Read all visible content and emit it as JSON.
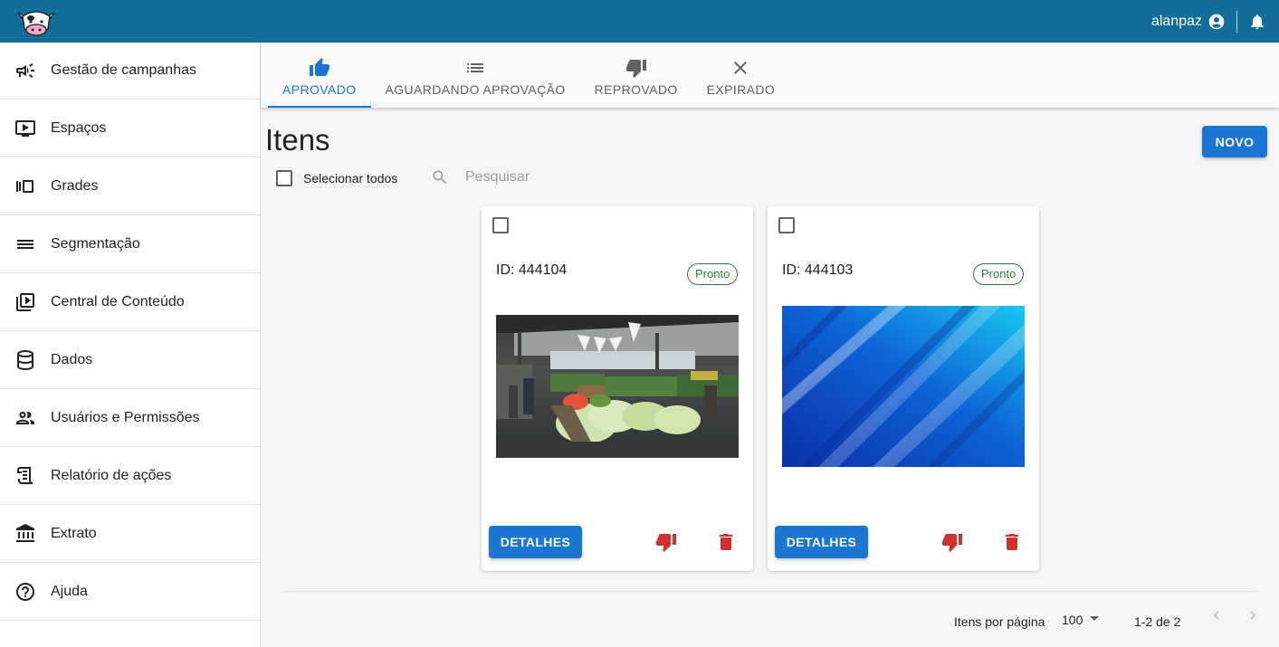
{
  "header": {
    "logo": "cow-logo",
    "username": "alanpaz",
    "user_icon": "account-circle-icon",
    "notifications_icon": "bell-icon"
  },
  "sidebar": {
    "items": [
      {
        "label": "Gestão de campanhas",
        "icon": "megaphone-icon"
      },
      {
        "label": "Espaços",
        "icon": "play-screen-icon"
      },
      {
        "label": "Grades",
        "icon": "carousel-icon"
      },
      {
        "label": "Segmentação",
        "icon": "lines-icon"
      },
      {
        "label": "Central de Conteúdo",
        "icon": "video-library-icon"
      },
      {
        "label": "Dados",
        "icon": "database-icon"
      },
      {
        "label": "Usuários e Permissões",
        "icon": "users-icon"
      },
      {
        "label": "Relatório de ações",
        "icon": "scroll-icon"
      },
      {
        "label": "Extrato",
        "icon": "bank-icon"
      },
      {
        "label": "Ajuda",
        "icon": "help-icon"
      }
    ]
  },
  "tabs": [
    {
      "label": "APROVADO",
      "icon": "thumb-up-icon",
      "active": true
    },
    {
      "label": "AGUARDANDO APROVAÇÃO",
      "icon": "list-icon",
      "active": false
    },
    {
      "label": "REPROVADO",
      "icon": "thumb-down-icon",
      "active": false
    },
    {
      "label": "EXPIRADO",
      "icon": "close-icon",
      "active": false
    }
  ],
  "main": {
    "title": "Itens",
    "new_button": "NOVO",
    "select_all_label": "Selecionar todos",
    "search_placeholder": "Pesquisar"
  },
  "cards": [
    {
      "id_label": "ID: 444104",
      "status": "Pronto",
      "image": "market-photo",
      "details_button": "DETALHES"
    },
    {
      "id_label": "ID: 444103",
      "status": "Pronto",
      "image": "blue-abstract-background",
      "details_button": "DETALHES"
    }
  ],
  "pagination": {
    "per_page_label": "Itens por página",
    "per_page_value": "100",
    "range": "1-2 de 2"
  },
  "colors": {
    "header": "#126d9b",
    "primary": "#1976d2",
    "status_green": "#2e7d32",
    "reject_red": "#d32f2f"
  }
}
